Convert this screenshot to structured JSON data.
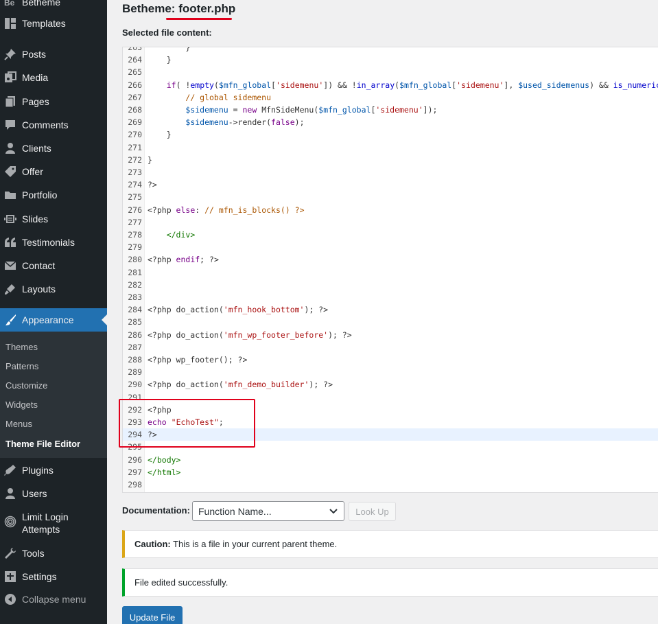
{
  "sidebar": {
    "top_partial_label": "Betheme",
    "items": [
      {
        "label": "Templates",
        "icon": "templates-icon"
      },
      {
        "label": "Posts",
        "icon": "pin-icon"
      },
      {
        "label": "Media",
        "icon": "media-icon"
      },
      {
        "label": "Pages",
        "icon": "pages-icon"
      },
      {
        "label": "Comments",
        "icon": "comment-icon"
      },
      {
        "label": "Clients",
        "icon": "user-icon"
      },
      {
        "label": "Offer",
        "icon": "tag-icon"
      },
      {
        "label": "Portfolio",
        "icon": "folder-icon"
      },
      {
        "label": "Slides",
        "icon": "slides-icon"
      },
      {
        "label": "Testimonials",
        "icon": "quote-icon"
      },
      {
        "label": "Contact",
        "icon": "envelope-icon"
      },
      {
        "label": "Layouts",
        "icon": "brush-icon"
      },
      {
        "label": "Appearance",
        "icon": "paintbrush-icon"
      }
    ],
    "submenu": [
      "Themes",
      "Patterns",
      "Customize",
      "Widgets",
      "Menus",
      "Theme File Editor"
    ],
    "bottom_items": [
      {
        "label": "Plugins",
        "icon": "plugin-icon"
      },
      {
        "label": "Users",
        "icon": "users-icon"
      },
      {
        "label": "Limit Login",
        "label2": "Attempts",
        "icon": "fingerprint-icon"
      },
      {
        "label": "Tools",
        "icon": "wrench-icon"
      },
      {
        "label": "Settings",
        "icon": "settings-icon"
      },
      {
        "label": "Collapse menu",
        "icon": "collapse-icon"
      }
    ]
  },
  "main": {
    "title_prefix": "Betheme: ",
    "title_file": "footer.php",
    "selected_label": "Selected file content:",
    "code": [
      {
        "n": "263",
        "segs": [
          [
            "p",
            "        }"
          ]
        ]
      },
      {
        "n": "264",
        "segs": [
          [
            "p",
            "    }"
          ]
        ]
      },
      {
        "n": "265",
        "segs": []
      },
      {
        "n": "266",
        "segs": [
          [
            "p",
            "    "
          ],
          [
            "k",
            "if"
          ],
          [
            "p",
            "( !"
          ],
          [
            "f",
            "empty"
          ],
          [
            "p",
            "("
          ],
          [
            "v",
            "$mfn_global"
          ],
          [
            "p",
            "["
          ],
          [
            "s",
            "'sidemenu'"
          ],
          [
            "p",
            "]) && !"
          ],
          [
            "f",
            "in_array"
          ],
          [
            "p",
            "("
          ],
          [
            "v",
            "$mfn_global"
          ],
          [
            "p",
            "["
          ],
          [
            "s",
            "'sidemenu'"
          ],
          [
            "p",
            "], "
          ],
          [
            "v",
            "$used_sidemenus"
          ],
          [
            "p",
            ") && "
          ],
          [
            "f",
            "is_numeric"
          ]
        ]
      },
      {
        "n": "267",
        "segs": [
          [
            "p",
            "        "
          ],
          [
            "c",
            "// global sidemenu"
          ]
        ]
      },
      {
        "n": "268",
        "segs": [
          [
            "p",
            "        "
          ],
          [
            "v",
            "$sidemenu"
          ],
          [
            "p",
            " = "
          ],
          [
            "k",
            "new"
          ],
          [
            "p",
            " MfnSideMenu("
          ],
          [
            "v",
            "$mfn_global"
          ],
          [
            "p",
            "["
          ],
          [
            "s",
            "'sidemenu'"
          ],
          [
            "p",
            "]);"
          ]
        ]
      },
      {
        "n": "269",
        "segs": [
          [
            "p",
            "        "
          ],
          [
            "v",
            "$sidemenu"
          ],
          [
            "p",
            "->render("
          ],
          [
            "k",
            "false"
          ],
          [
            "p",
            ");"
          ]
        ]
      },
      {
        "n": "270",
        "segs": [
          [
            "p",
            "    }"
          ]
        ]
      },
      {
        "n": "271",
        "segs": []
      },
      {
        "n": "272",
        "segs": [
          [
            "p",
            "}"
          ]
        ]
      },
      {
        "n": "273",
        "segs": []
      },
      {
        "n": "274",
        "segs": [
          [
            "p",
            "?>"
          ]
        ]
      },
      {
        "n": "275",
        "segs": []
      },
      {
        "n": "276",
        "segs": [
          [
            "p",
            "<?php "
          ],
          [
            "k",
            "else"
          ],
          [
            "p",
            ": "
          ],
          [
            "c",
            "// mfn_is_blocks() ?>"
          ]
        ]
      },
      {
        "n": "277",
        "segs": []
      },
      {
        "n": "278",
        "segs": [
          [
            "p",
            "    "
          ],
          [
            "t",
            "</div>"
          ]
        ]
      },
      {
        "n": "279",
        "segs": []
      },
      {
        "n": "280",
        "segs": [
          [
            "p",
            "<?php "
          ],
          [
            "k",
            "endif"
          ],
          [
            "p",
            "; ?>"
          ]
        ]
      },
      {
        "n": "281",
        "segs": []
      },
      {
        "n": "282",
        "segs": []
      },
      {
        "n": "283",
        "segs": []
      },
      {
        "n": "284",
        "segs": [
          [
            "p",
            "<?php do_action("
          ],
          [
            "s",
            "'mfn_hook_bottom'"
          ],
          [
            "p",
            "); ?>"
          ]
        ]
      },
      {
        "n": "285",
        "segs": []
      },
      {
        "n": "286",
        "segs": [
          [
            "p",
            "<?php do_action("
          ],
          [
            "s",
            "'mfn_wp_footer_before'"
          ],
          [
            "p",
            "); ?>"
          ]
        ]
      },
      {
        "n": "287",
        "segs": []
      },
      {
        "n": "288",
        "segs": [
          [
            "p",
            "<?php wp_footer(); ?>"
          ]
        ]
      },
      {
        "n": "289",
        "segs": []
      },
      {
        "n": "290",
        "segs": [
          [
            "p",
            "<?php do_action("
          ],
          [
            "s",
            "'mfn_demo_builder'"
          ],
          [
            "p",
            "); ?>"
          ]
        ]
      },
      {
        "n": "291",
        "segs": []
      },
      {
        "n": "292",
        "segs": [
          [
            "p",
            "<?php"
          ]
        ]
      },
      {
        "n": "293",
        "segs": [
          [
            "k",
            "echo"
          ],
          [
            "p",
            " "
          ],
          [
            "s",
            "\"EchoTest\""
          ],
          [
            "p",
            ";"
          ]
        ]
      },
      {
        "n": "294",
        "segs": [
          [
            "p",
            "?>"
          ]
        ]
      },
      {
        "n": "295",
        "segs": []
      },
      {
        "n": "296",
        "segs": [
          [
            "t",
            "</body>"
          ]
        ]
      },
      {
        "n": "297",
        "segs": [
          [
            "t",
            "</html>"
          ]
        ]
      },
      {
        "n": "298",
        "segs": []
      }
    ],
    "documentation_label": "Documentation:",
    "function_select_value": "Function Name...",
    "lookup_label": "Look Up",
    "caution_bold": "Caution:",
    "caution_text": " This is a file in your current parent theme.",
    "success_text": "File edited successfully.",
    "update_label": "Update File"
  },
  "colors": {
    "sidebar_bg": "#1d2327",
    "accent": "#2271b1",
    "annotation_red": "#e0001b",
    "caution_border": "#dba617",
    "success_border": "#00a32a"
  }
}
